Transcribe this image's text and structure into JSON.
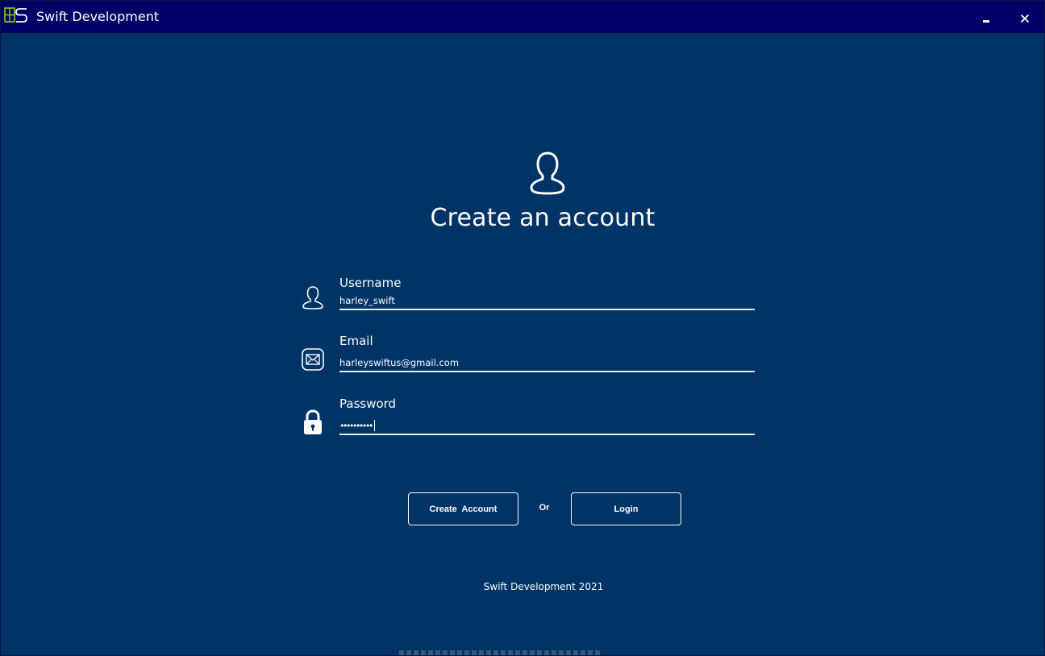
{
  "window": {
    "title": "Swift Development",
    "minimize_label": "Minimize",
    "close_label": "Close",
    "colors": {
      "titlebar": "#000066",
      "background": "#003366",
      "app_icon": "#8fd400"
    }
  },
  "form": {
    "heading": "Create an account",
    "username": {
      "label": "Username",
      "value": "harley_swift"
    },
    "email": {
      "label": "Email",
      "value": "harleyswiftus@gmail.com"
    },
    "password": {
      "label": "Password",
      "masked_value": "••••••••••"
    }
  },
  "actions": {
    "create_label": "Create  Account",
    "or_text": "Or",
    "login_label": "Login"
  },
  "footer": {
    "text": "Swift Development 2021"
  },
  "icons": [
    "app-logo-icon",
    "minimize-icon",
    "close-icon",
    "profile-icon",
    "user-icon",
    "envelope-icon",
    "lock-icon"
  ]
}
